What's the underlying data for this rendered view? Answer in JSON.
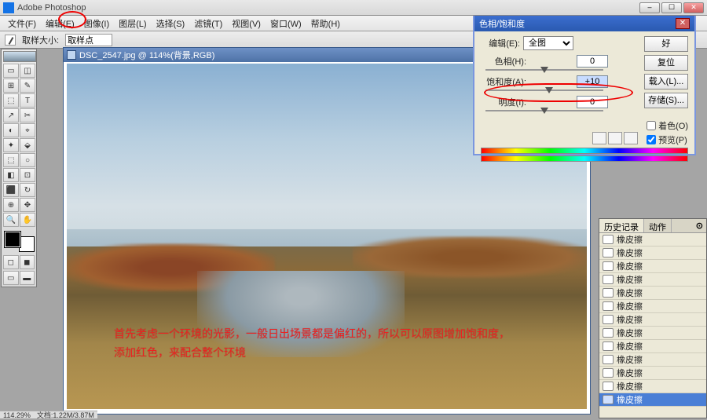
{
  "app": {
    "title": "Adobe Photoshop"
  },
  "menubar": [
    "文件(F)",
    "编辑(E)",
    "图像(I)",
    "图层(L)",
    "选择(S)",
    "滤镜(T)",
    "视图(V)",
    "窗口(W)",
    "帮助(H)"
  ],
  "optbar": {
    "sample_label": "取样大小:",
    "sample_value": "取样点"
  },
  "doc": {
    "title": "DSC_2547.jpg @ 114%(背景,RGB)"
  },
  "overlay": {
    "line1": "首先考虑一个环境的光影，一般日出场景都是偏红的，所以可以原图增加饱和度，",
    "line2": "添加红色，来配合整个环境"
  },
  "dialog": {
    "title": "色相/饱和度",
    "edit_label": "编辑(E):",
    "edit_value": "全图",
    "hue_label": "色相(H):",
    "hue_value": "0",
    "sat_label": "饱和度(A):",
    "sat_value": "+10",
    "light_label": "明度(I):",
    "light_value": "0",
    "btn_ok": "好",
    "btn_reset": "复位",
    "btn_load": "载入(L)...",
    "btn_save": "存储(S)...",
    "chk_colorize": "着色(O)",
    "chk_preview": "预览(P)"
  },
  "history": {
    "tab1": "历史记录",
    "tab2": "动作",
    "items": [
      "橡皮擦",
      "橡皮擦",
      "橡皮擦",
      "橡皮擦",
      "橡皮擦",
      "橡皮擦",
      "橡皮擦",
      "橡皮擦",
      "橡皮擦",
      "橡皮擦",
      "橡皮擦",
      "橡皮擦",
      "橡皮擦"
    ]
  },
  "status": {
    "zoom": "114.29%",
    "docinfo": "文档:1.22M/3.87M"
  },
  "tools": [
    "▭",
    "◫",
    "⊞",
    "✎",
    "⬚",
    "T",
    "↗",
    "✂",
    "◐",
    "⌖",
    "✦",
    "⬙",
    "⬚",
    "○",
    "◧",
    "⊡",
    "⬛",
    "↻",
    "⊕",
    "✥",
    "🔍",
    "✋"
  ]
}
